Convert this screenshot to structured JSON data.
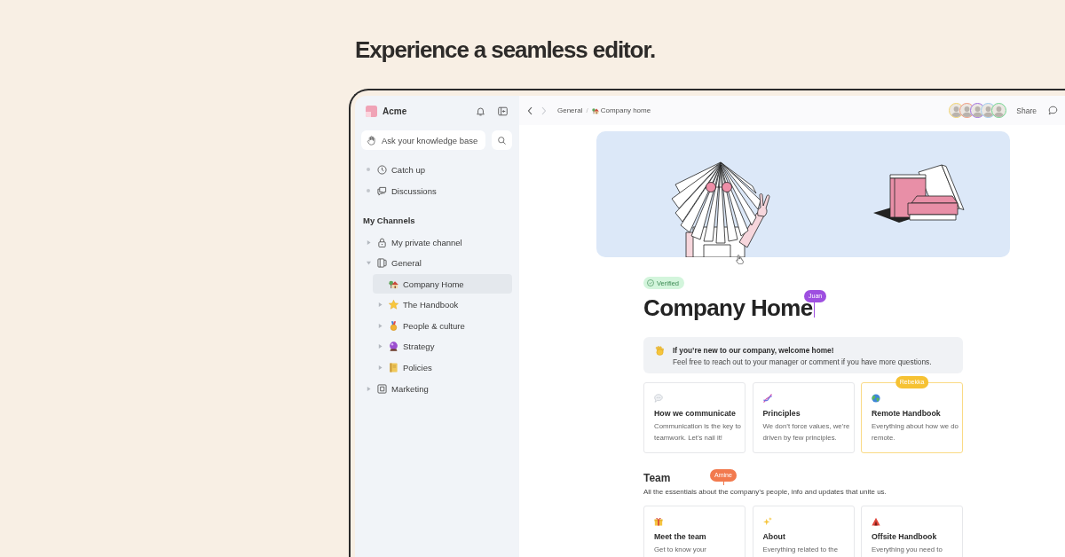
{
  "headline": "Experience a seamless editor.",
  "sidebar": {
    "workspace": "Acme",
    "search": {
      "placeholder": "Ask your knowledge base"
    },
    "nav": [
      {
        "label": "Catch up",
        "selected": false
      },
      {
        "label": "Discussions",
        "selected": false
      }
    ],
    "section_title": "My Channels",
    "channels": [
      {
        "label": "My private channel",
        "kind": "folder",
        "expanded": false,
        "selected": false
      },
      {
        "label": "General",
        "kind": "folder",
        "expanded": true,
        "selected": false,
        "children": [
          {
            "label": "Company Home",
            "kind": "page",
            "expanded": false,
            "selected": true
          },
          {
            "label": "The Handbook",
            "kind": "folder",
            "expanded": false,
            "selected": false
          },
          {
            "label": "People & culture",
            "kind": "folder",
            "expanded": false,
            "selected": false
          },
          {
            "label": "Strategy",
            "kind": "folder",
            "expanded": false,
            "selected": false
          },
          {
            "label": "Policies",
            "kind": "folder",
            "expanded": false,
            "selected": false
          }
        ]
      },
      {
        "label": "Marketing",
        "kind": "folder",
        "expanded": false,
        "selected": false
      }
    ]
  },
  "topbar": {
    "back": {
      "disabled": false
    },
    "forward": {
      "disabled": true
    },
    "breadcrumb": [
      {
        "label": "General"
      },
      {
        "label": "Company home"
      }
    ],
    "separator": "/",
    "avatars": [
      {
        "color": "#f3d46e"
      },
      {
        "color": "#f09a7c"
      },
      {
        "color": "#a06fe0"
      },
      {
        "color": "#9ccbee"
      },
      {
        "color": "#72d690"
      }
    ],
    "share": "Share"
  },
  "page": {
    "badge": "Verified",
    "title": "Company Home",
    "title_cursor": {
      "name": "Juan",
      "color": "#9e4fe0"
    },
    "callout": {
      "heading": "If you’re new to our company, welcome home!",
      "text": "Feel free to reach out to your manager or comment if you have more questions."
    },
    "cards": [
      {
        "title": "How we communicate",
        "description": "Communication is the key to teamwork. Let’s nail it!"
      },
      {
        "title": "Principles",
        "description": "We don’t force values, we’re driven by few principles."
      },
      {
        "title": "Remote Handbook",
        "description": "Everything about how we do remote.",
        "cursor": {
          "name": "Rebekka",
          "color": "#f6c233"
        }
      }
    ],
    "sections": [
      {
        "heading": "Team",
        "description": "All the essentials about the company’s people, info and updates that unite us.",
        "cursor": {
          "name": "Amine",
          "color": "#f27a4e"
        },
        "cards": [
          {
            "title": "Meet the team",
            "description": "Get to know your"
          },
          {
            "title": "About",
            "description": "Everything related to the"
          },
          {
            "title": "Offsite Handbook",
            "description": "Everything you need to"
          }
        ]
      }
    ]
  }
}
